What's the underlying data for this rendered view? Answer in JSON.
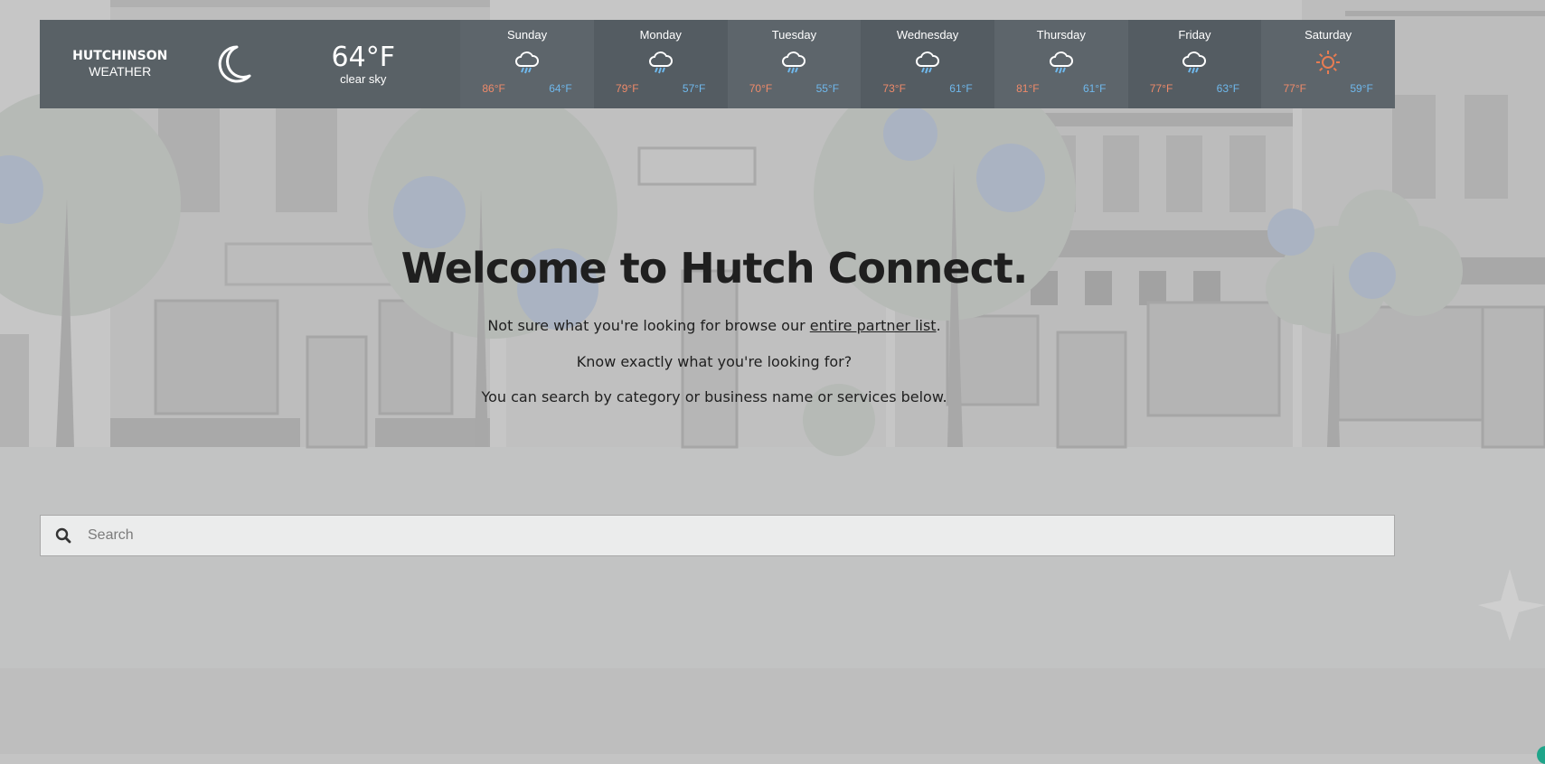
{
  "weather": {
    "city_line1": "HUTCHINSON",
    "city_line2": "WEATHER",
    "current_icon": "moon-icon",
    "current_temp": "64°F",
    "current_desc": "clear sky",
    "days": [
      {
        "name": "Sunday",
        "icon": "rain-cloud-icon",
        "high": "86°F",
        "low": "64°F"
      },
      {
        "name": "Monday",
        "icon": "rain-cloud-icon",
        "high": "79°F",
        "low": "57°F"
      },
      {
        "name": "Tuesday",
        "icon": "rain-cloud-icon",
        "high": "70°F",
        "low": "55°F"
      },
      {
        "name": "Wednesday",
        "icon": "rain-cloud-icon",
        "high": "73°F",
        "low": "61°F"
      },
      {
        "name": "Thursday",
        "icon": "rain-cloud-icon",
        "high": "81°F",
        "low": "61°F"
      },
      {
        "name": "Friday",
        "icon": "rain-cloud-icon",
        "high": "77°F",
        "low": "63°F"
      },
      {
        "name": "Saturday",
        "icon": "sun-icon",
        "high": "77°F",
        "low": "59°F"
      }
    ],
    "colors": {
      "bar": "#596166",
      "high": "#ee8a6a",
      "low": "#6fb8ec",
      "sun": "#e87c52"
    }
  },
  "hero": {
    "title": "Welcome to Hutch Connect.",
    "line1_prefix": "Not sure what you're looking for browse our ",
    "line1_link": "entire partner list",
    "line1_suffix": ".",
    "line2": "Know exactly what you're looking for?",
    "line3": "You can search by category or business name or services below."
  },
  "search": {
    "placeholder": "Search",
    "icon": "search-icon"
  }
}
